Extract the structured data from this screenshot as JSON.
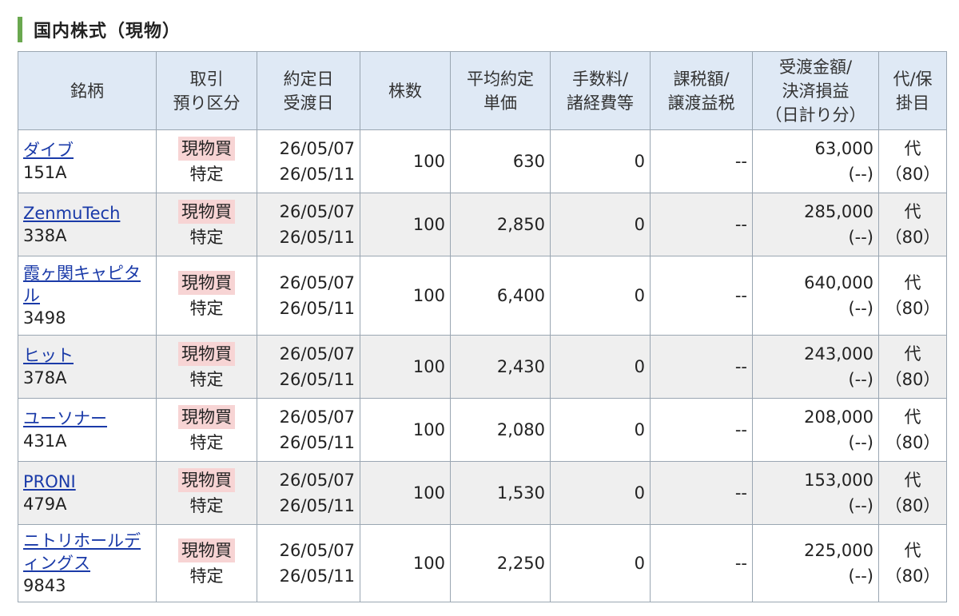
{
  "section": {
    "title": "国内株式（現物）"
  },
  "table": {
    "headers": [
      {
        "key": "name",
        "lines": [
          "銘柄"
        ]
      },
      {
        "key": "kubun",
        "lines": [
          "取引",
          "預り区分"
        ]
      },
      {
        "key": "dates",
        "lines": [
          "約定日",
          "受渡日"
        ]
      },
      {
        "key": "shares",
        "lines": [
          "株数"
        ]
      },
      {
        "key": "price",
        "lines": [
          "平均約定",
          "単価"
        ]
      },
      {
        "key": "fee",
        "lines": [
          "手数料/",
          "諸経費等"
        ]
      },
      {
        "key": "tax",
        "lines": [
          "課税額/",
          "譲渡益税"
        ]
      },
      {
        "key": "amount",
        "lines": [
          "受渡金額/",
          "決済損益",
          "（日計り分）"
        ]
      },
      {
        "key": "dai",
        "lines": [
          "代/保",
          "掛目"
        ]
      }
    ],
    "rows": [
      {
        "name": "ダイブ",
        "code": "151A",
        "trade": "現物買",
        "account": "特定",
        "trade_date": "26/05/07",
        "settle_date": "26/05/11",
        "shares": "100",
        "price": "630",
        "fee": "0",
        "tax": "--",
        "amount": "63,000",
        "pl": "(--)",
        "dai": "代",
        "rate": "（80）"
      },
      {
        "name": "ZenmuTech",
        "code": "338A",
        "trade": "現物買",
        "account": "特定",
        "trade_date": "26/05/07",
        "settle_date": "26/05/11",
        "shares": "100",
        "price": "2,850",
        "fee": "0",
        "tax": "--",
        "amount": "285,000",
        "pl": "(--)",
        "dai": "代",
        "rate": "（80）"
      },
      {
        "name": "霞ヶ関キャピタル",
        "code": "3498",
        "trade": "現物買",
        "account": "特定",
        "trade_date": "26/05/07",
        "settle_date": "26/05/11",
        "shares": "100",
        "price": "6,400",
        "fee": "0",
        "tax": "--",
        "amount": "640,000",
        "pl": "(--)",
        "dai": "代",
        "rate": "（80）"
      },
      {
        "name": "ヒット",
        "code": "378A",
        "trade": "現物買",
        "account": "特定",
        "trade_date": "26/05/07",
        "settle_date": "26/05/11",
        "shares": "100",
        "price": "2,430",
        "fee": "0",
        "tax": "--",
        "amount": "243,000",
        "pl": "(--)",
        "dai": "代",
        "rate": "（80）"
      },
      {
        "name": "ユーソナー",
        "code": "431A",
        "trade": "現物買",
        "account": "特定",
        "trade_date": "26/05/07",
        "settle_date": "26/05/11",
        "shares": "100",
        "price": "2,080",
        "fee": "0",
        "tax": "--",
        "amount": "208,000",
        "pl": "(--)",
        "dai": "代",
        "rate": "（80）"
      },
      {
        "name": "PRONI",
        "code": "479A",
        "trade": "現物買",
        "account": "特定",
        "trade_date": "26/05/07",
        "settle_date": "26/05/11",
        "shares": "100",
        "price": "1,530",
        "fee": "0",
        "tax": "--",
        "amount": "153,000",
        "pl": "(--)",
        "dai": "代",
        "rate": "（80）"
      },
      {
        "name": "ニトリホールディングス",
        "code": "9843",
        "trade": "現物買",
        "account": "特定",
        "trade_date": "26/05/07",
        "settle_date": "26/05/11",
        "shares": "100",
        "price": "2,250",
        "fee": "0",
        "tax": "--",
        "amount": "225,000",
        "pl": "(--)",
        "dai": "代",
        "rate": "（80）"
      }
    ]
  },
  "colors": {
    "accent_bar": "#6aa84f",
    "header_bg": "#dfe9f5",
    "link": "#1a3aa8",
    "badge_bg": "#f7d4d4",
    "row_alt_bg": "#efefef",
    "border": "#9aa6b2"
  }
}
